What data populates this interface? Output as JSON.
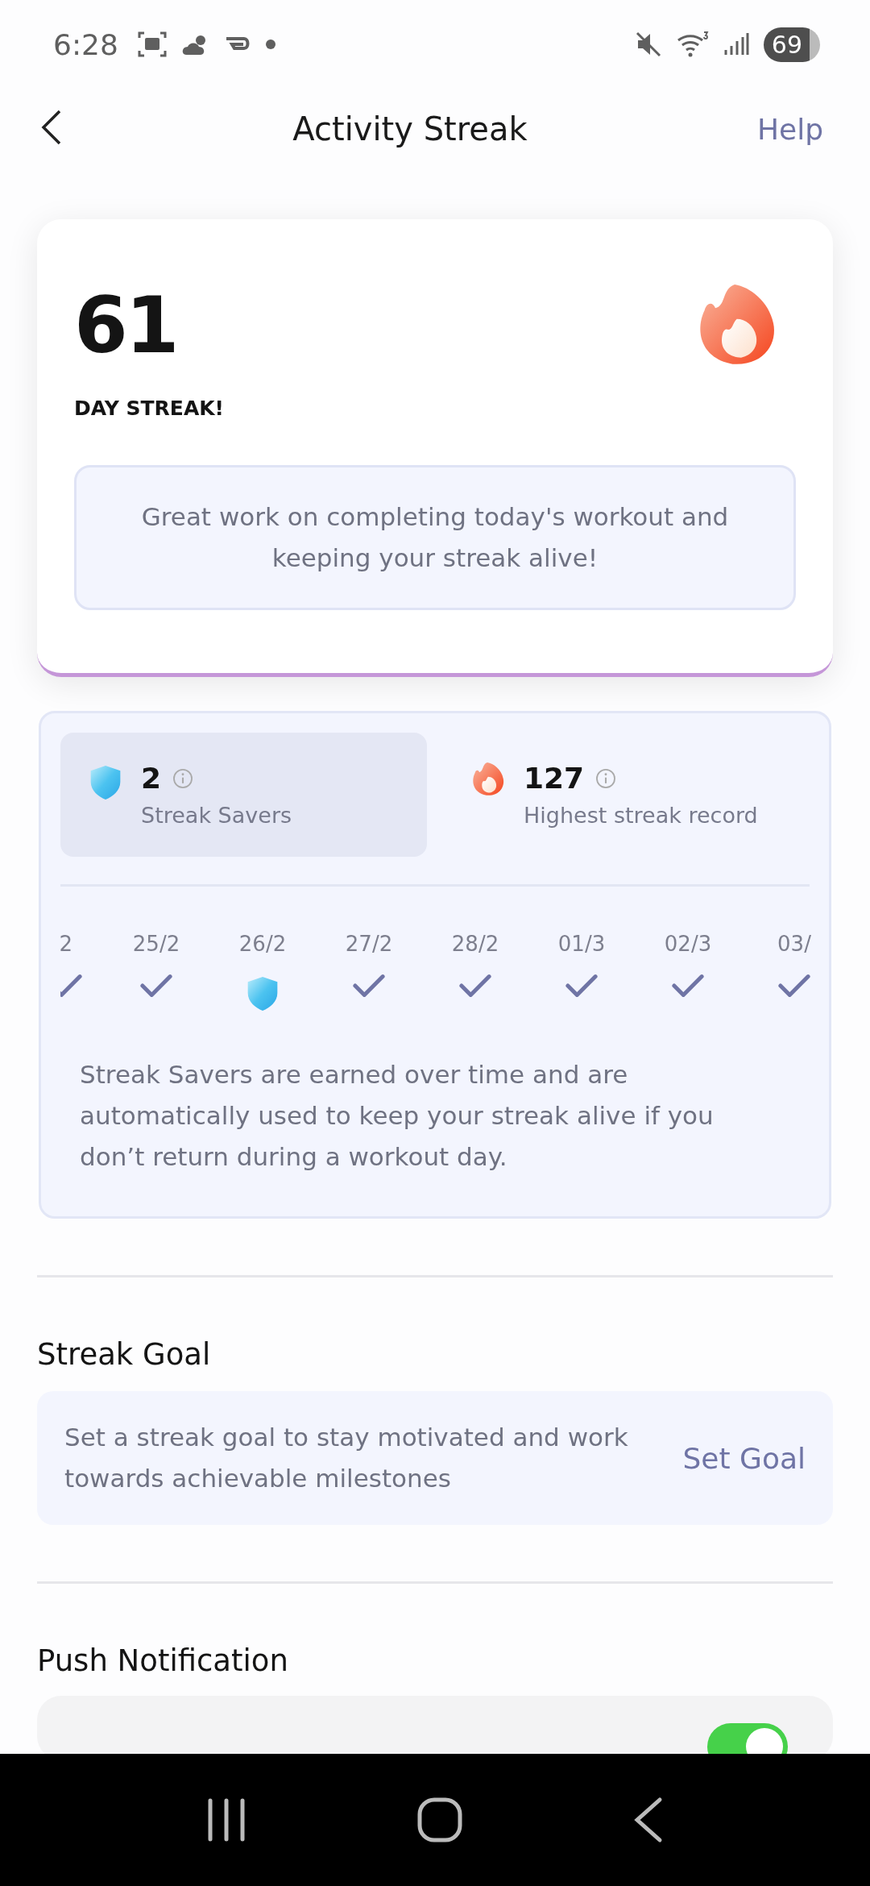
{
  "status_bar": {
    "time": "6:28",
    "battery": "69"
  },
  "header": {
    "title": "Activity Streak",
    "action": "Help"
  },
  "streak": {
    "count": "61",
    "label": "DAY STREAK!",
    "message": "Great work on completing today's workout and keeping your streak alive!"
  },
  "stats": [
    {
      "kind": "saver",
      "value": "2",
      "label": "Streak Savers",
      "selected": true
    },
    {
      "kind": "record",
      "value": "127",
      "label": "Highest streak record",
      "selected": false
    }
  ],
  "days": [
    {
      "date": "2",
      "kind": "check"
    },
    {
      "date": "25/2",
      "kind": "check"
    },
    {
      "date": "26/2",
      "kind": "saver"
    },
    {
      "date": "27/2",
      "kind": "check"
    },
    {
      "date": "28/2",
      "kind": "check"
    },
    {
      "date": "01/3",
      "kind": "check"
    },
    {
      "date": "02/3",
      "kind": "check"
    },
    {
      "date": "03/",
      "kind": "check"
    }
  ],
  "savers_info": "Streak Savers are earned over time and are automatically used to keep your streak alive if you don’t return during a workout day.",
  "goal": {
    "title": "Streak Goal",
    "text": "Set a streak goal to stay motivated and work towards achievable milestones",
    "action": "Set Goal"
  },
  "push": {
    "title": "Push Notification",
    "toggle": {
      "on": true
    }
  }
}
